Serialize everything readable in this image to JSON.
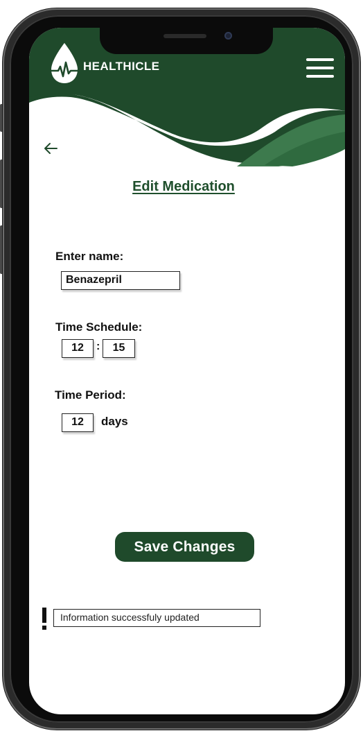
{
  "app": {
    "brand": "HEALTHICLE",
    "brand_color": "#1f4a2b",
    "accent_color": "#2f6a3f"
  },
  "header": {
    "logo_icon": "heartbeat-drop-icon",
    "menu_icon": "hamburger-menu-icon",
    "back_icon": "arrow-left-icon"
  },
  "page": {
    "title": "Edit Medication"
  },
  "form": {
    "name_label": "Enter name:",
    "name_value": "Benazepril",
    "schedule_label": "Time Schedule:",
    "schedule_hour": "12",
    "schedule_separator": ":",
    "schedule_minute": "15",
    "period_label": "Time Period:",
    "period_value": "12",
    "period_unit": "days"
  },
  "actions": {
    "save_label": "Save Changes"
  },
  "status": {
    "icon": "exclamation-icon",
    "message": "Information successfuly updated"
  }
}
